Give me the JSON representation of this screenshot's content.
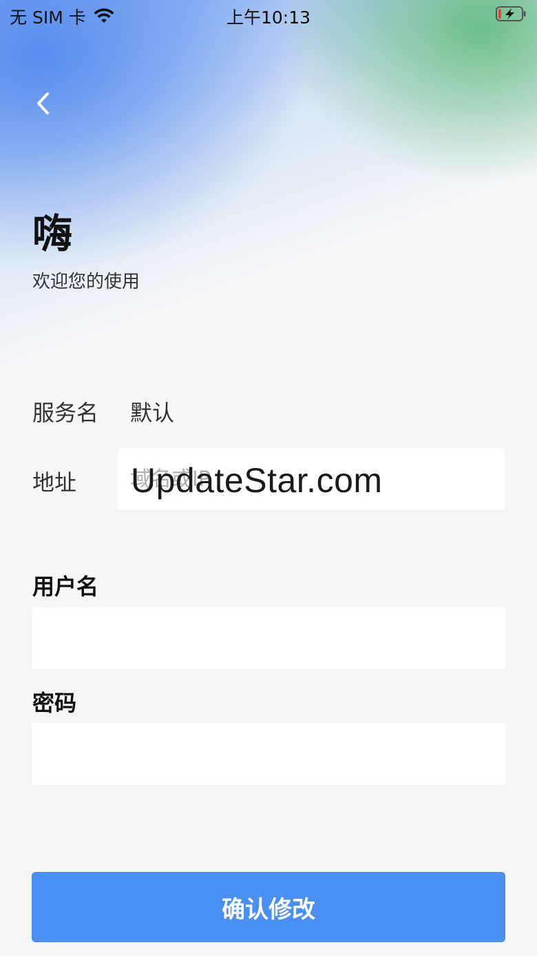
{
  "status_bar": {
    "carrier": "无 SIM 卡",
    "time": "上午10:13",
    "icons": [
      "wifi-icon",
      "battery-charging-icon"
    ]
  },
  "header": {
    "back_icon": "chevron-left-icon",
    "greeting": "嗨",
    "welcome": "欢迎您的使用"
  },
  "form": {
    "service_label": "服务名",
    "service_value": "默认",
    "address_label": "地址",
    "address_placeholder": "域名或IP",
    "address_value": "",
    "username_label": "用户名",
    "username_value": "",
    "password_label": "密码",
    "password_value": ""
  },
  "actions": {
    "confirm_label": "确认修改"
  },
  "watermark": "UpdateStar.com",
  "colors": {
    "primary": "#4a8ff2",
    "background": "#f6f6f7",
    "input_bg": "#ffffff"
  }
}
